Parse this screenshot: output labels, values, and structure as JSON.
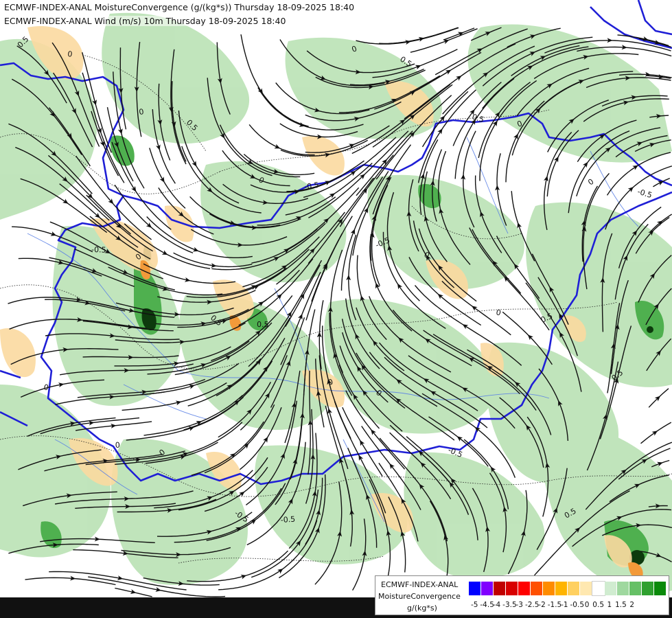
{
  "header": {
    "line1": "ECMWF-INDEX-ANAL MoistureConvergence (g/(kg*s)) Thursday 18-09-2025 18:40",
    "line2": "ECMWF-INDEX-ANAL Wind (m/s) 10m Thursday 18-09-2025 18:40"
  },
  "map": {
    "contour_labels": [
      "0.5",
      "0",
      "0",
      "-0.5",
      "0",
      "0.5",
      "0",
      "-0.5",
      "0",
      "0.5",
      "0",
      "-0.5",
      "0.5",
      "0",
      "-0.5",
      "0.5",
      "0",
      "0.5",
      "-0.5",
      "0",
      "0.5",
      "0",
      "0",
      "-0.5",
      "0.5",
      "0",
      "-0.5",
      "0",
      "0.5",
      "0"
    ],
    "colors": {
      "border": "#1f1fd6",
      "river": "#3f6fe0",
      "streamline": "#111111",
      "contour": "#222222"
    }
  },
  "legend": {
    "source": "ECMWF-INDEX-ANAL",
    "variable": "MoistureConvergence",
    "unit": "g/(kg*s)",
    "colors": [
      "#0000ff",
      "#8000ff",
      "#c00000",
      "#d80000",
      "#ff0000",
      "#ff5000",
      "#ff8c00",
      "#ffb400",
      "#ffd060",
      "#ffe8b0",
      "#ffffff",
      "#d0ecd0",
      "#9fd89f",
      "#66c066",
      "#2fa02f",
      "#0a8a0a"
    ],
    "ticks": [
      "-5",
      "-4.5",
      "-4",
      "-3.5",
      "-3",
      "-2.5",
      "-2",
      "-1.5",
      "-1",
      "-0.5",
      "0",
      "0.5",
      "1",
      "1.5",
      "2"
    ]
  }
}
